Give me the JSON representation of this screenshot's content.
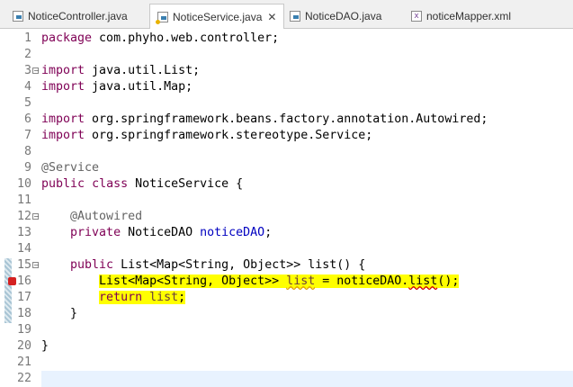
{
  "tabs": [
    {
      "label": "NoticeController.java",
      "icon": "java-file-icon"
    },
    {
      "label": "NoticeService.java",
      "icon": "java-file-warning-icon",
      "active": true
    },
    {
      "label": "NoticeDAO.java",
      "icon": "java-file-icon"
    },
    {
      "label": "noticeMapper.xml",
      "icon": "xml-file-icon"
    }
  ],
  "close_glyph": "✕",
  "lines": [
    {
      "n": "1",
      "code": [
        {
          "t": "package",
          "c": "kw"
        },
        {
          "t": " com.phyho.web.controller;"
        }
      ]
    },
    {
      "n": "2",
      "code": []
    },
    {
      "n": "3",
      "fold": true,
      "code": [
        {
          "t": "import",
          "c": "kw"
        },
        {
          "t": " java.util.List;"
        }
      ]
    },
    {
      "n": "4",
      "code": [
        {
          "t": "import",
          "c": "kw"
        },
        {
          "t": " java.util.Map;"
        }
      ]
    },
    {
      "n": "5",
      "code": []
    },
    {
      "n": "6",
      "code": [
        {
          "t": "import",
          "c": "kw"
        },
        {
          "t": " org.springframework.beans.factory.annotation.Autowired;"
        }
      ]
    },
    {
      "n": "7",
      "code": [
        {
          "t": "import",
          "c": "kw"
        },
        {
          "t": " org.springframework.stereotype.Service;"
        }
      ]
    },
    {
      "n": "8",
      "code": []
    },
    {
      "n": "9",
      "code": [
        {
          "t": "@Service",
          "c": "ann"
        }
      ]
    },
    {
      "n": "10",
      "code": [
        {
          "t": "public",
          "c": "kw"
        },
        {
          "t": " "
        },
        {
          "t": "class",
          "c": "kw"
        },
        {
          "t": " NoticeService {"
        }
      ]
    },
    {
      "n": "11",
      "code": []
    },
    {
      "n": "12",
      "fold": true,
      "code": [
        {
          "t": "    "
        },
        {
          "t": "@Autowired",
          "c": "ann"
        }
      ]
    },
    {
      "n": "13",
      "code": [
        {
          "t": "    "
        },
        {
          "t": "private",
          "c": "kw"
        },
        {
          "t": " NoticeDAO "
        },
        {
          "t": "noticeDAO",
          "c": "fld"
        },
        {
          "t": ";"
        }
      ]
    },
    {
      "n": "14",
      "code": []
    },
    {
      "n": "15",
      "fold": true,
      "code": [
        {
          "t": "    "
        },
        {
          "t": "public",
          "c": "kw"
        },
        {
          "t": " List<Map<String, Object>> list() {"
        }
      ]
    },
    {
      "n": "16",
      "error": true,
      "code": [
        {
          "t": "        "
        },
        {
          "t": "List<Map<String, Object>> ",
          "c": "hl"
        },
        {
          "t": "list",
          "c": "hl var warnU"
        },
        {
          "t": " = noticeDAO.",
          "c": "hl"
        },
        {
          "t": "list",
          "c": "hl errU"
        },
        {
          "t": "();",
          "c": "hl"
        }
      ]
    },
    {
      "n": "17",
      "code": [
        {
          "t": "        "
        },
        {
          "t": "return",
          "c": "kw hl"
        },
        {
          "t": " ",
          "c": "hl"
        },
        {
          "t": "list",
          "c": "hl var"
        },
        {
          "t": ";",
          "c": "hl"
        }
      ]
    },
    {
      "n": "18",
      "code": [
        {
          "t": "    }"
        }
      ]
    },
    {
      "n": "19",
      "code": []
    },
    {
      "n": "20",
      "code": [
        {
          "t": "}"
        }
      ]
    },
    {
      "n": "21",
      "code": []
    },
    {
      "n": "22",
      "current": true,
      "code": []
    }
  ]
}
